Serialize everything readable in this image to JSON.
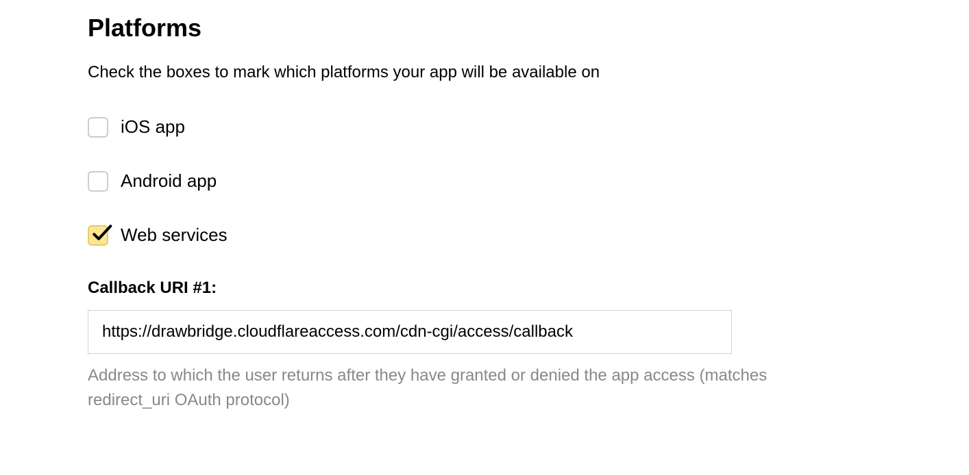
{
  "section": {
    "title": "Platforms",
    "description": "Check the boxes to mark which platforms your app will be available on"
  },
  "platforms": [
    {
      "label": "iOS app",
      "checked": false
    },
    {
      "label": "Android app",
      "checked": false
    },
    {
      "label": "Web services",
      "checked": true
    }
  ],
  "callback": {
    "label": "Callback URI #1:",
    "value": "https://drawbridge.cloudflareaccess.com/cdn-cgi/access/callback",
    "help": "Address to which the user returns after they have granted or denied the app access (matches redirect_uri OAuth protocol)"
  }
}
